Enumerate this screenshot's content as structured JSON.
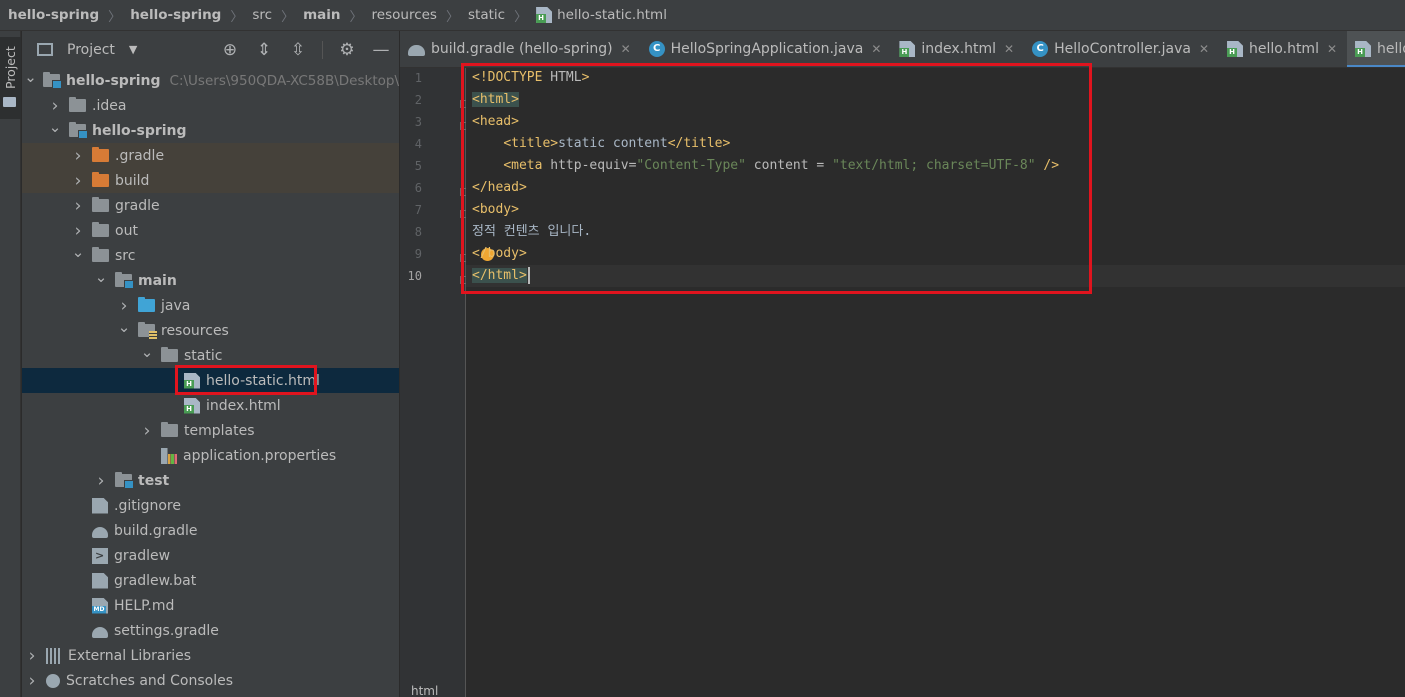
{
  "breadcrumb": [
    {
      "label": "hello-spring",
      "bold": true
    },
    {
      "label": "hello-spring",
      "bold": true
    },
    {
      "label": "src",
      "bold": false
    },
    {
      "label": "main",
      "bold": true
    },
    {
      "label": "resources",
      "bold": false
    },
    {
      "label": "static",
      "bold": false
    },
    {
      "label": "hello-static.html",
      "bold": false,
      "icon": "html-file-icon"
    }
  ],
  "stripe": {
    "label": "Project"
  },
  "project_panel": {
    "title": "Project",
    "tools": [
      "locate-icon",
      "expand-all-icon",
      "collapse-all-icon",
      "gear-icon",
      "minimize-icon"
    ]
  },
  "tree": [
    {
      "label": "hello-spring",
      "path": "C:\\Users\\950QDA-XC58B\\Desktop\\",
      "depth": 0,
      "arrow": "down",
      "icon": "module",
      "bold": true
    },
    {
      "label": ".idea",
      "depth": 1,
      "arrow": "right",
      "icon": "folder"
    },
    {
      "label": "hello-spring",
      "depth": 1,
      "arrow": "down",
      "icon": "module",
      "bold": true
    },
    {
      "label": ".gradle",
      "depth": 2,
      "arrow": "right",
      "icon": "folder-orange",
      "excluded": true
    },
    {
      "label": "build",
      "depth": 2,
      "arrow": "right",
      "icon": "folder-orange",
      "excluded": true
    },
    {
      "label": "gradle",
      "depth": 2,
      "arrow": "right",
      "icon": "folder"
    },
    {
      "label": "out",
      "depth": 2,
      "arrow": "right",
      "icon": "folder"
    },
    {
      "label": "src",
      "depth": 2,
      "arrow": "down",
      "icon": "folder"
    },
    {
      "label": "main",
      "depth": 3,
      "arrow": "down",
      "icon": "module",
      "bold": true
    },
    {
      "label": "java",
      "depth": 4,
      "arrow": "right",
      "icon": "folder-blue"
    },
    {
      "label": "resources",
      "depth": 4,
      "arrow": "down",
      "icon": "resources"
    },
    {
      "label": "static",
      "depth": 5,
      "arrow": "down",
      "icon": "folder"
    },
    {
      "label": "hello-static.html",
      "depth": 6,
      "arrow": "none",
      "icon": "html",
      "selected": true
    },
    {
      "label": "index.html",
      "depth": 6,
      "arrow": "none",
      "icon": "html"
    },
    {
      "label": "templates",
      "depth": 5,
      "arrow": "right",
      "icon": "folder"
    },
    {
      "label": "application.properties",
      "depth": 5,
      "arrow": "none",
      "icon": "props"
    },
    {
      "label": "test",
      "depth": 3,
      "arrow": "right",
      "icon": "module",
      "bold": true
    },
    {
      "label": ".gitignore",
      "depth": 2,
      "arrow": "none",
      "icon": "gitignore"
    },
    {
      "label": "build.gradle",
      "depth": 2,
      "arrow": "none",
      "icon": "gradle"
    },
    {
      "label": "gradlew",
      "depth": 2,
      "arrow": "none",
      "icon": "term"
    },
    {
      "label": "gradlew.bat",
      "depth": 2,
      "arrow": "none",
      "icon": "doc"
    },
    {
      "label": "HELP.md",
      "depth": 2,
      "arrow": "none",
      "icon": "md"
    },
    {
      "label": "settings.gradle",
      "depth": 2,
      "arrow": "none",
      "icon": "gradle"
    },
    {
      "label": "External Libraries",
      "depth": 0,
      "arrow": "right",
      "icon": "libs"
    },
    {
      "label": "Scratches and Consoles",
      "depth": 0,
      "arrow": "right",
      "icon": "scratch"
    }
  ],
  "tabs": [
    {
      "label": "build.gradle (hello-spring)",
      "icon": "gradle-tab",
      "active": false
    },
    {
      "label": "HelloSpringApplication.java",
      "icon": "java-c",
      "active": false
    },
    {
      "label": "index.html",
      "icon": "html",
      "active": false
    },
    {
      "label": "HelloController.java",
      "icon": "java-c",
      "active": false
    },
    {
      "label": "hello.html",
      "icon": "html",
      "active": false
    },
    {
      "label": "hello-static.html",
      "icon": "html",
      "active": true
    }
  ],
  "editor": {
    "line_numbers": [
      "1",
      "2",
      "3",
      "4",
      "5",
      "6",
      "7",
      "8",
      "9",
      "10"
    ],
    "current_line": "10",
    "lines": [
      {
        "indent": "",
        "tokens": [
          {
            "t": "<!DOCTYPE ",
            "c": "tag"
          },
          {
            "t": "HTML",
            "c": "attr"
          },
          {
            "t": ">",
            "c": "tag"
          }
        ]
      },
      {
        "indent": "",
        "tokens": [
          {
            "t": "<html>",
            "c": "tag tag-hl"
          }
        ]
      },
      {
        "indent": "",
        "tokens": [
          {
            "t": "<head>",
            "c": "tag"
          }
        ]
      },
      {
        "indent": "    ",
        "tokens": [
          {
            "t": "<title>",
            "c": "tag"
          },
          {
            "t": "static content",
            "c": "txt"
          },
          {
            "t": "</title>",
            "c": "tag"
          }
        ]
      },
      {
        "indent": "    ",
        "tokens": [
          {
            "t": "<meta ",
            "c": "tag"
          },
          {
            "t": "http-equiv",
            "c": "attr"
          },
          {
            "t": "=",
            "c": "attr"
          },
          {
            "t": "\"Content-Type\"",
            "c": "str"
          },
          {
            "t": " content ",
            "c": "attr"
          },
          {
            "t": "= ",
            "c": "attr"
          },
          {
            "t": "\"text/html; charset=UTF-8\"",
            "c": "str"
          },
          {
            "t": " />",
            "c": "tag"
          }
        ]
      },
      {
        "indent": "",
        "tokens": [
          {
            "t": "</head>",
            "c": "tag"
          }
        ]
      },
      {
        "indent": "",
        "tokens": [
          {
            "t": "<body>",
            "c": "tag"
          }
        ]
      },
      {
        "indent": "",
        "tokens": [
          {
            "t": "정적 컨텐츠 입니다.",
            "c": "txt"
          }
        ]
      },
      {
        "indent": "",
        "tokens": [
          {
            "t": "</body>",
            "c": "tag"
          }
        ]
      },
      {
        "indent": "",
        "tokens": [
          {
            "t": "</html>",
            "c": "tag tag-hl"
          }
        ],
        "caret": true
      }
    ]
  },
  "status": {
    "text": "html"
  },
  "colors": {
    "highlight_box": "#e0141e",
    "tab_underline": "#4a88c7"
  }
}
